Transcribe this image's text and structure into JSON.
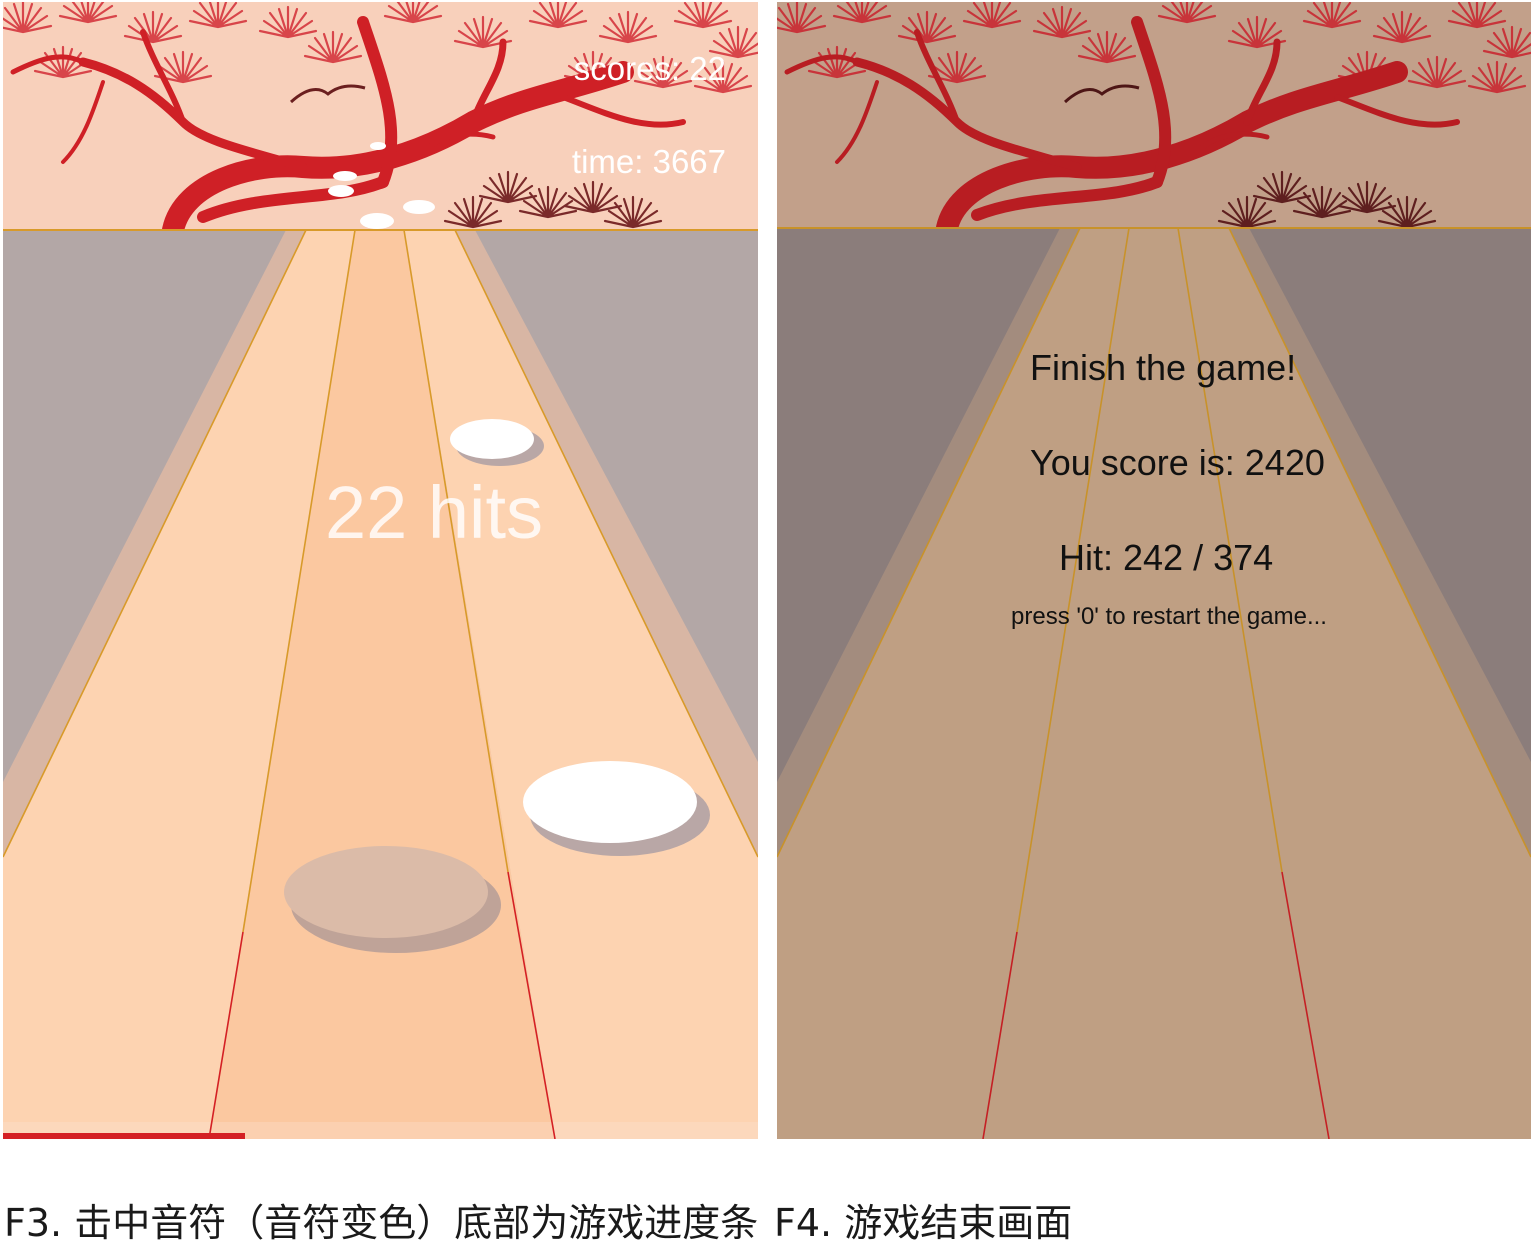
{
  "panels": {
    "left": {
      "hud": {
        "scores": "scores: 22",
        "time": "time: 3667"
      },
      "combo": "22 hits",
      "progress": 0.32
    },
    "right": {
      "end_screen": {
        "title": "Finish the game!",
        "score": "You score is: 2420",
        "hits": "Hit: 242 / 374",
        "hint": "press '0' to restart the game..."
      }
    }
  },
  "captions": {
    "f3": "F3.  击中音符（音符变色）底部为游戏进度条",
    "f4": "F4.  游戏结束画面"
  },
  "colors": {
    "sky_left": "#f8d0bb",
    "sky_right": "#c2a08a",
    "branch": "#cf2026",
    "wall_left": "#b3a7a6",
    "wall_right": "#8b7d7b",
    "lane_light": "#fdd3b1",
    "lane_mid": "#fbc8a0",
    "lane_dark": "#bf9f83",
    "lane_line": "#d89a2a",
    "red_line": "#d42024",
    "note": "#ffffff",
    "note_hit": "#dbbba8"
  },
  "icons": {
    "scenery": "red-pine-tree-icon",
    "bird": "flying-bird-icon",
    "note": "disc-note-icon"
  }
}
